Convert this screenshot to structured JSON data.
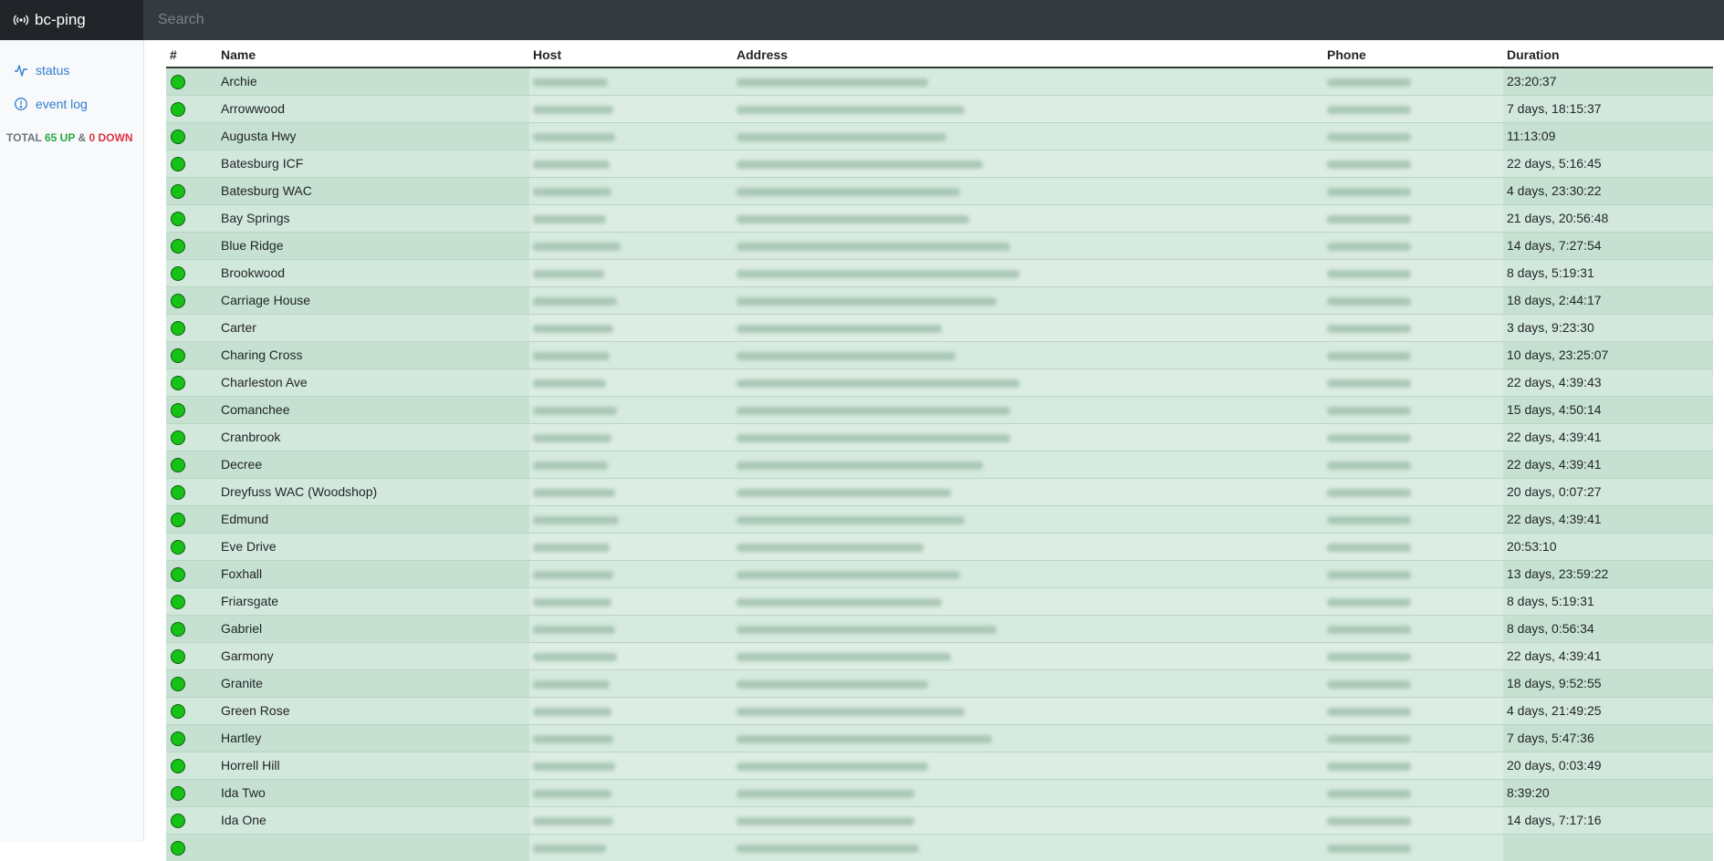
{
  "app": {
    "title": "bc-ping",
    "icon": "broadcast-icon"
  },
  "search": {
    "placeholder": "Search"
  },
  "sidebar": {
    "items": [
      {
        "label": "status",
        "icon": "activity-icon"
      },
      {
        "label": "event log",
        "icon": "info-circle-icon"
      }
    ],
    "total": {
      "prefix": "TOTAL ",
      "up": "65 UP",
      "sep": " & ",
      "down": "0 DOWN"
    }
  },
  "table": {
    "headers": {
      "status": "#",
      "name": "Name",
      "host": "Host",
      "address": "Address",
      "phone": "Phone",
      "duration": "Duration"
    },
    "rows": [
      {
        "name": "Archie",
        "duration": "23:20:37"
      },
      {
        "name": "Arrowwood",
        "duration": "7 days, 18:15:37"
      },
      {
        "name": "Augusta Hwy",
        "duration": "11:13:09"
      },
      {
        "name": "Batesburg ICF",
        "duration": "22 days, 5:16:45"
      },
      {
        "name": "Batesburg WAC",
        "duration": "4 days, 23:30:22"
      },
      {
        "name": "Bay Springs",
        "duration": "21 days, 20:56:48"
      },
      {
        "name": "Blue Ridge",
        "duration": "14 days, 7:27:54"
      },
      {
        "name": "Brookwood",
        "duration": "8 days, 5:19:31"
      },
      {
        "name": "Carriage House",
        "duration": "18 days, 2:44:17"
      },
      {
        "name": "Carter",
        "duration": "3 days, 9:23:30"
      },
      {
        "name": "Charing Cross",
        "duration": "10 days, 23:25:07"
      },
      {
        "name": "Charleston Ave",
        "duration": "22 days, 4:39:43"
      },
      {
        "name": "Comanchee",
        "duration": "15 days, 4:50:14"
      },
      {
        "name": "Cranbrook",
        "duration": "22 days, 4:39:41"
      },
      {
        "name": "Decree",
        "duration": "22 days, 4:39:41"
      },
      {
        "name": "Dreyfuss WAC (Woodshop)",
        "duration": "20 days, 0:07:27"
      },
      {
        "name": "Edmund",
        "duration": "22 days, 4:39:41"
      },
      {
        "name": "Eve Drive",
        "duration": "20:53:10"
      },
      {
        "name": "Foxhall",
        "duration": "13 days, 23:59:22"
      },
      {
        "name": "Friarsgate",
        "duration": "8 days, 5:19:31"
      },
      {
        "name": "Gabriel",
        "duration": "8 days, 0:56:34"
      },
      {
        "name": "Garmony",
        "duration": "22 days, 4:39:41"
      },
      {
        "name": "Granite",
        "duration": "18 days, 9:52:55"
      },
      {
        "name": "Green Rose",
        "duration": "4 days, 21:49:25"
      },
      {
        "name": "Hartley",
        "duration": "7 days, 5:47:36"
      },
      {
        "name": "Horrell Hill",
        "duration": "20 days, 0:03:49"
      },
      {
        "name": "Ida Two",
        "duration": "8:39:20"
      },
      {
        "name": "Ida One",
        "duration": "14 days, 7:17:16"
      },
      {
        "name": "",
        "duration": ""
      }
    ]
  },
  "colors": {
    "up": "#16c216",
    "rowA": "#c6e1d2",
    "rowB": "#d3e8dc",
    "topbar": "#343a40",
    "link": "#2f7fd1"
  }
}
